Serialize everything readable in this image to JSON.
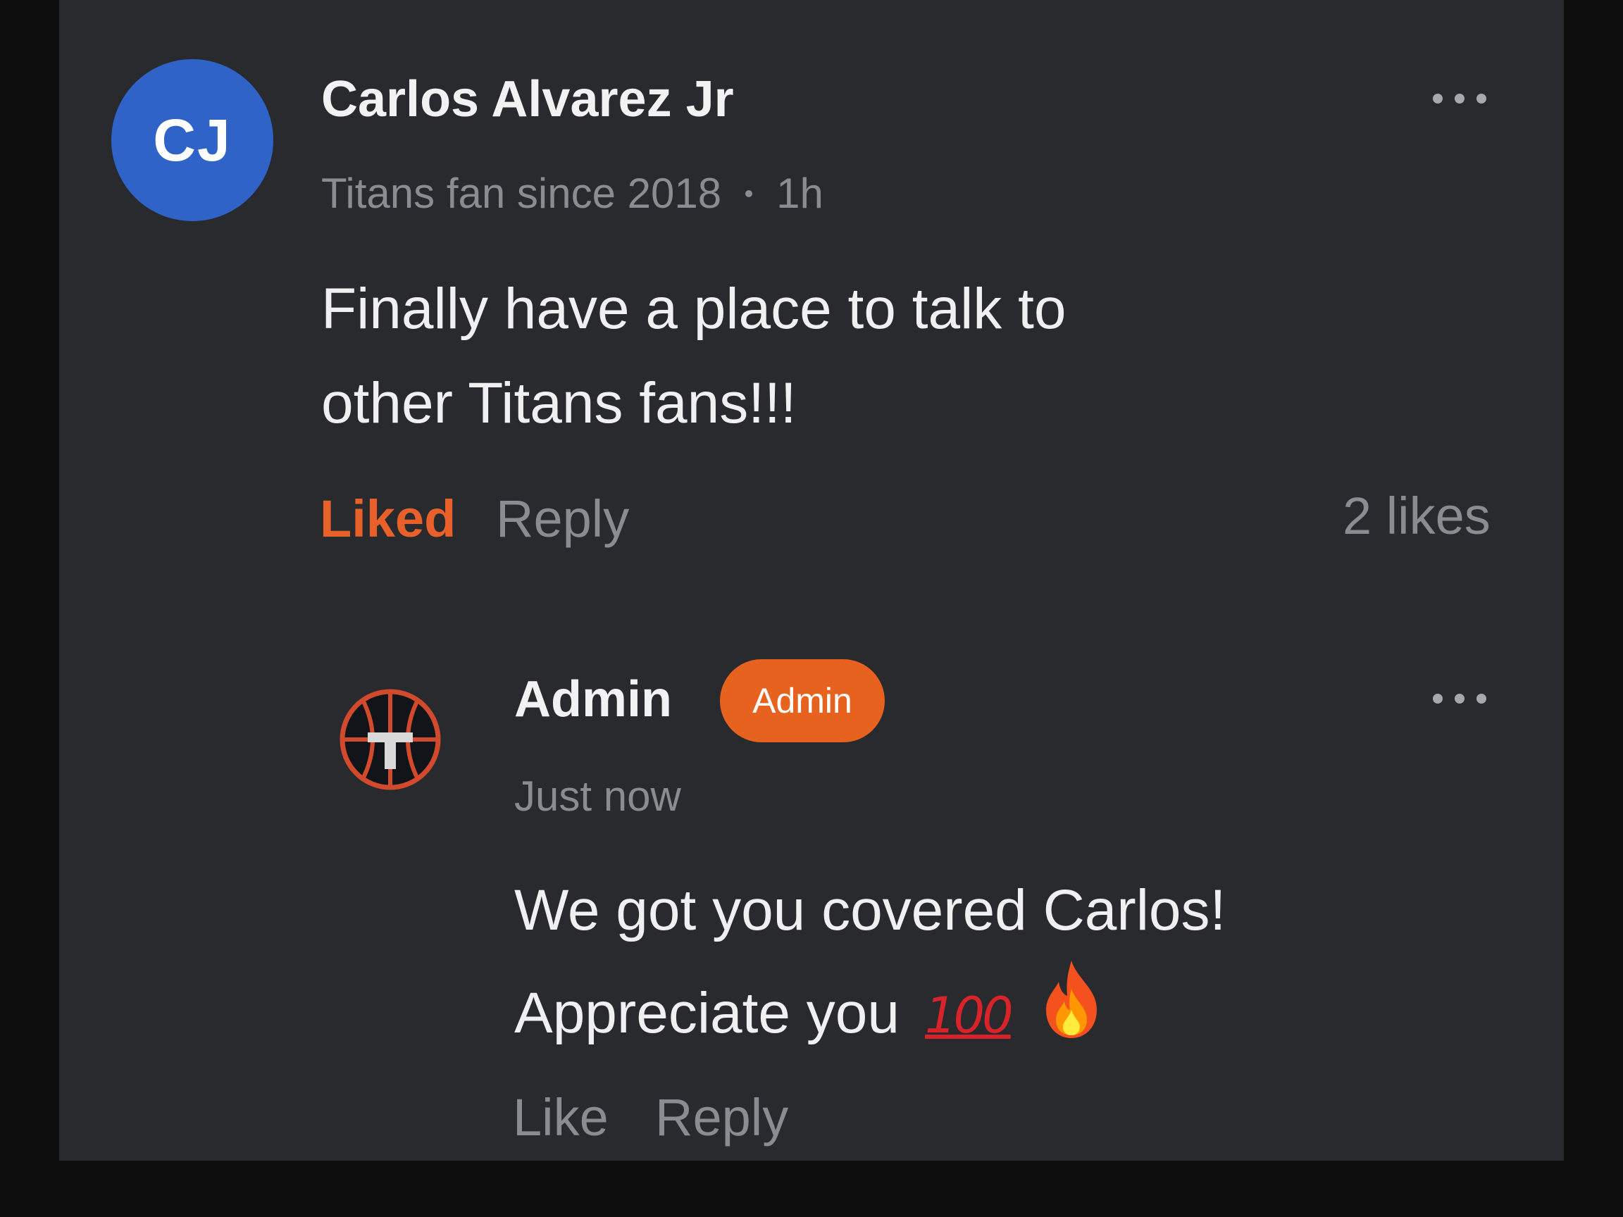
{
  "comment": {
    "avatar_initials": "CJ",
    "avatar_color": "#2f63c8",
    "author": "Carlos Alvarez Jr",
    "subtitle": "Titans fan since 2018",
    "time": "1h",
    "body_line1": "Finally have a place to talk to",
    "body_line2": "other Titans fans!!!",
    "like_label": "Liked",
    "liked": true,
    "reply_label": "Reply",
    "likes_count": "2 likes"
  },
  "reply": {
    "author": "Admin",
    "badge": "Admin",
    "time": "Just now",
    "body_line1": "We got you covered Carlos!",
    "body_line2": "Appreciate you",
    "emoji_hundred": "100",
    "emoji_fire": "fire-emoji",
    "like_label": "Like",
    "reply_label": "Reply"
  },
  "colors": {
    "background": "#0e0e0f",
    "card": "#292a2e",
    "accent": "#e8612a",
    "muted_text": "#8b8c91",
    "primary_text": "#f0f0f1"
  }
}
